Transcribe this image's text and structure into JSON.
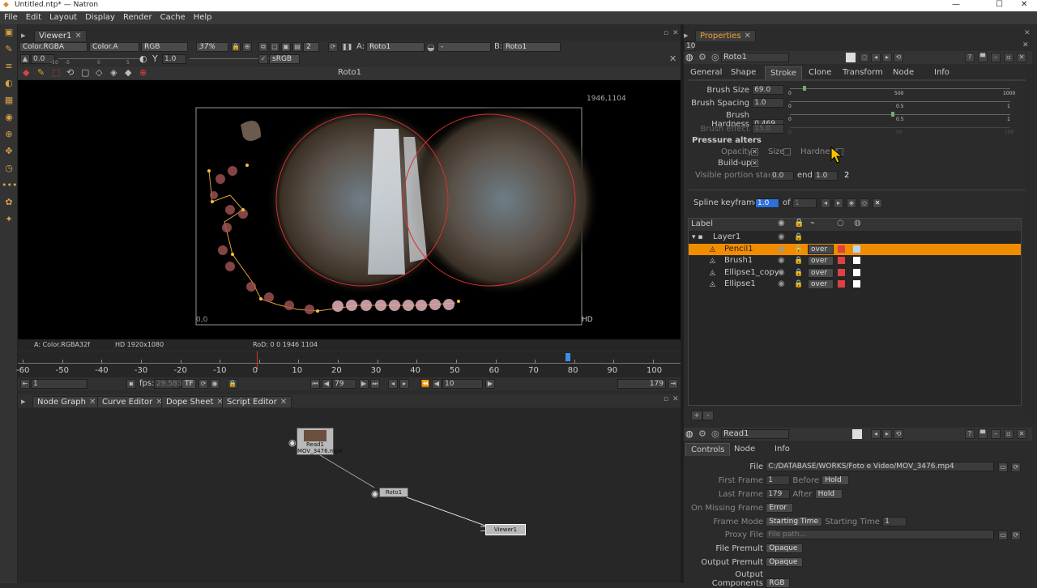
{
  "window": {
    "title": "Untitled.ntp* — Natron",
    "min": "—",
    "max": "☐",
    "close": "✕"
  },
  "menu": [
    "File",
    "Edit",
    "Layout",
    "Display",
    "Render",
    "Cache",
    "Help"
  ],
  "viewer": {
    "tab": "Viewer1",
    "layer": "Color.RGBA",
    "alpha": "Color.A",
    "channels": "RGB",
    "zoom": "37%",
    "proxy": "2",
    "inputA_label": "A:",
    "inputA": "Roto1",
    "inputB_label": "B:",
    "inputB": "Roto1",
    "wipe": "-",
    "gain": "0.0",
    "gamma_label": "Y",
    "gamma": "1.0",
    "colorspace": "sRGB",
    "title": "Roto1",
    "coord_top": "1946,1104",
    "coord_origin": "0,0",
    "format_tag": "HD",
    "info_left": "A: Color.RGBA32f",
    "info_format": "HD 1920x1080",
    "info_rod": "RoD: 0 0 1946 1104",
    "ruler_ticks": [
      "-10",
      "-5",
      "0",
      "5"
    ]
  },
  "timeline": {
    "ticks": [
      "-60",
      "-50",
      "-40",
      "-30",
      "-20",
      "-10",
      "0",
      "10",
      "20",
      "30",
      "40",
      "50",
      "60",
      "70",
      "80",
      "90",
      "100"
    ],
    "start": "1",
    "fps_label": "fps:",
    "fps": "29.583",
    "tf": "TF",
    "current": "79",
    "step": "10",
    "end": "179"
  },
  "bottom_tabs": [
    "Node Graph",
    "Curve Editor",
    "Dope Sheet",
    "Script Editor"
  ],
  "nodes": {
    "read": "Read1",
    "read_file": "MOV_3476.mp4",
    "roto": "Roto1",
    "viewer": "Viewer1"
  },
  "properties": {
    "tab": "Properties",
    "max_panels": "10",
    "node_name": "Roto1",
    "tabs": [
      "General",
      "Shape",
      "Stroke",
      "Clone",
      "Transform",
      "Node",
      "Info"
    ],
    "brush_size_label": "Brush Size",
    "brush_size": "69.0",
    "brush_spacing_label": "Brush Spacing",
    "brush_spacing": "1.0",
    "brush_hardness_label": "Brush Hardness",
    "brush_hardness": "0.469",
    "brush_effect_label": "Brush effect",
    "brush_effect": "15.0",
    "slider_ticks_a": [
      "0",
      "500",
      "1000"
    ],
    "slider_ticks_b": [
      "0",
      "0.5",
      "1"
    ],
    "slider_ticks_c": [
      "0",
      "50",
      "100"
    ],
    "pressure_title": "Pressure alters",
    "opacity_label": "Opacity",
    "size_label": "Size",
    "hardness_label": "Hardness",
    "buildup_label": "Build-up",
    "visible_label": "Visible portion start",
    "visible_start": "0.0",
    "end_label": "end",
    "visible_end": "1.0",
    "visible_extra": "2",
    "spline_label": "Spline keyframe:",
    "spline_value": "1.0",
    "of_label": "of",
    "spline_total": "1",
    "layer_header": "Label",
    "layers": [
      {
        "name": "Layer1",
        "indent": 1,
        "selected": false,
        "op": "",
        "color": ""
      },
      {
        "name": "Pencil1",
        "indent": 2,
        "selected": true,
        "op": "over",
        "color": "#e04040",
        "overlay": "#b8d8f0"
      },
      {
        "name": "Brush1",
        "indent": 2,
        "selected": false,
        "op": "over",
        "color": "#e04040",
        "overlay": "#ffffff"
      },
      {
        "name": "Ellipse1_copy",
        "indent": 2,
        "selected": false,
        "op": "over",
        "color": "#e04040",
        "overlay": "#ffffff"
      },
      {
        "name": "Ellipse1",
        "indent": 2,
        "selected": false,
        "op": "over",
        "color": "#e04040",
        "overlay": "#ffffff"
      }
    ],
    "add": "+",
    "remove": "-"
  },
  "read_panel": {
    "node_name": "Read1",
    "tabs": [
      "Controls",
      "Node",
      "Info"
    ],
    "file_label": "File",
    "file": "C:/DATABASE/WORKS/Foto e Video/MOV_3476.mp4",
    "first_frame_label": "First Frame",
    "first_frame": "1",
    "before_label": "Before",
    "before": "Hold",
    "last_frame_label": "Last Frame",
    "last_frame": "179",
    "after_label": "After",
    "after": "Hold",
    "missing_label": "On Missing Frame",
    "missing": "Error",
    "frame_mode_label": "Frame Mode",
    "frame_mode": "Starting Time",
    "starting_time_label": "Starting Time",
    "starting_time": "1",
    "proxy_label": "Proxy File",
    "proxy_placeholder": "File path...",
    "file_premult_label": "File Premult",
    "file_premult": "Opaque",
    "output_premult_label": "Output Premult",
    "output_premult": "Opaque",
    "output_comp_label": "Output Components",
    "output_comp": "RGB"
  },
  "colors": {
    "accent": "#f0a030",
    "selection": "#f08c00",
    "playhead": "#e03030",
    "keyframe": "#3a8ee6"
  }
}
